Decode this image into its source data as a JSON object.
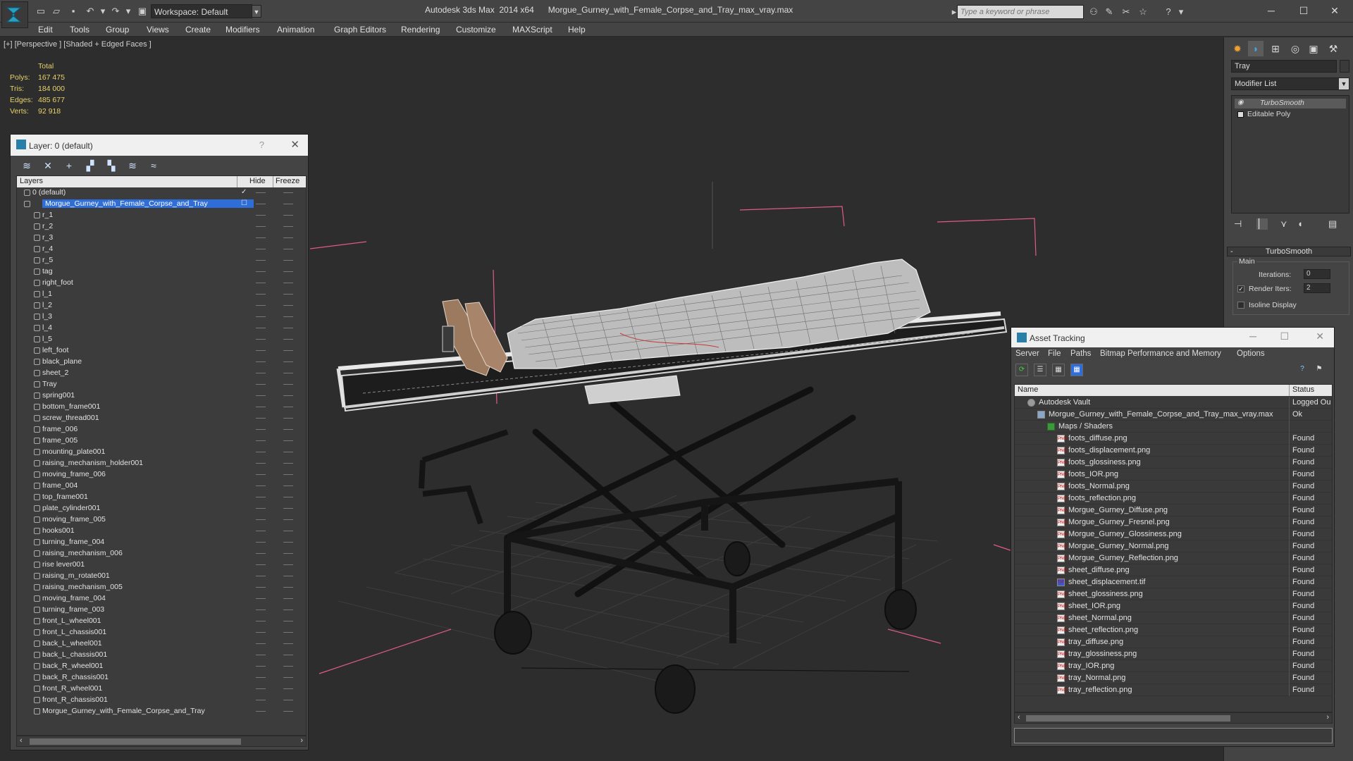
{
  "title_bar": {
    "workspace_label": "Workspace: Default",
    "window_title": "Autodesk 3ds Max  2014 x64      Morgue_Gurney_with_Female_Corpse_and_Tray_max_vray.max",
    "search_placeholder": "Type a keyword or phrase"
  },
  "menu": [
    "Edit",
    "Tools",
    "Group",
    "Views",
    "Create",
    "Modifiers",
    "Animation",
    "Graph Editors",
    "Rendering",
    "Customize",
    "MAXScript",
    "Help"
  ],
  "viewport": {
    "label": "[+] [Perspective ] [Shaded + Edged Faces ]",
    "stats": {
      "header": "Total",
      "rows": [
        {
          "label": "Polys:",
          "value": "167 475"
        },
        {
          "label": "Tris:",
          "value": "184 000"
        },
        {
          "label": "Edges:",
          "value": "485 677"
        },
        {
          "label": "Verts:",
          "value": "92 918"
        }
      ]
    }
  },
  "layer_panel": {
    "title": "Layer: 0 (default)",
    "help": "?",
    "columns": {
      "layers": "Layers",
      "hide": "Hide",
      "freeze": "Freeze"
    },
    "rows": [
      {
        "name": "0 (default)",
        "level": 0,
        "kind": "layer"
      },
      {
        "name": "Morgue_Gurney_with_Female_Corpse_and_Tray",
        "level": 0,
        "kind": "layer",
        "selected": true
      },
      {
        "name": "r_1",
        "level": 1,
        "kind": "object"
      },
      {
        "name": "r_2",
        "level": 1,
        "kind": "object"
      },
      {
        "name": "r_3",
        "level": 1,
        "kind": "object"
      },
      {
        "name": "r_4",
        "level": 1,
        "kind": "object"
      },
      {
        "name": "r_5",
        "level": 1,
        "kind": "object"
      },
      {
        "name": "tag",
        "level": 1,
        "kind": "object"
      },
      {
        "name": "right_foot",
        "level": 1,
        "kind": "object"
      },
      {
        "name": "l_1",
        "level": 1,
        "kind": "object"
      },
      {
        "name": "l_2",
        "level": 1,
        "kind": "object"
      },
      {
        "name": "l_3",
        "level": 1,
        "kind": "object"
      },
      {
        "name": "l_4",
        "level": 1,
        "kind": "object"
      },
      {
        "name": "l_5",
        "level": 1,
        "kind": "object"
      },
      {
        "name": "left_foot",
        "level": 1,
        "kind": "object"
      },
      {
        "name": "black_plane",
        "level": 1,
        "kind": "object"
      },
      {
        "name": "sheet_2",
        "level": 1,
        "kind": "object"
      },
      {
        "name": "Tray",
        "level": 1,
        "kind": "object"
      },
      {
        "name": "spring001",
        "level": 1,
        "kind": "object"
      },
      {
        "name": "bottom_frame001",
        "level": 1,
        "kind": "object"
      },
      {
        "name": "screw_thread001",
        "level": 1,
        "kind": "object"
      },
      {
        "name": "frame_006",
        "level": 1,
        "kind": "object"
      },
      {
        "name": "frame_005",
        "level": 1,
        "kind": "object"
      },
      {
        "name": "mounting_plate001",
        "level": 1,
        "kind": "object"
      },
      {
        "name": "raising_mechanism_holder001",
        "level": 1,
        "kind": "object"
      },
      {
        "name": "moving_frame_006",
        "level": 1,
        "kind": "object"
      },
      {
        "name": "frame_004",
        "level": 1,
        "kind": "object"
      },
      {
        "name": "top_frame001",
        "level": 1,
        "kind": "object"
      },
      {
        "name": "plate_cylinder001",
        "level": 1,
        "kind": "object"
      },
      {
        "name": "moving_frame_005",
        "level": 1,
        "kind": "object"
      },
      {
        "name": "hooks001",
        "level": 1,
        "kind": "object"
      },
      {
        "name": "turning_frame_004",
        "level": 1,
        "kind": "object"
      },
      {
        "name": "raising_mechanism_006",
        "level": 1,
        "kind": "object"
      },
      {
        "name": "rise lever001",
        "level": 1,
        "kind": "object"
      },
      {
        "name": "raising_m_rotate001",
        "level": 1,
        "kind": "object"
      },
      {
        "name": "raising_mechanism_005",
        "level": 1,
        "kind": "object"
      },
      {
        "name": "moving_frame_004",
        "level": 1,
        "kind": "object"
      },
      {
        "name": "turning_frame_003",
        "level": 1,
        "kind": "object"
      },
      {
        "name": "front_L_wheel001",
        "level": 1,
        "kind": "object"
      },
      {
        "name": "front_L_chassis001",
        "level": 1,
        "kind": "object"
      },
      {
        "name": "back_L_wheel001",
        "level": 1,
        "kind": "object"
      },
      {
        "name": "back_L_chassis001",
        "level": 1,
        "kind": "object"
      },
      {
        "name": "back_R_wheel001",
        "level": 1,
        "kind": "object"
      },
      {
        "name": "back_R_chassis001",
        "level": 1,
        "kind": "object"
      },
      {
        "name": "front_R_wheel001",
        "level": 1,
        "kind": "object"
      },
      {
        "name": "front_R_chassis001",
        "level": 1,
        "kind": "object"
      },
      {
        "name": "Morgue_Gurney_with_Female_Corpse_and_Tray",
        "level": 1,
        "kind": "object"
      }
    ]
  },
  "command_panel": {
    "object_name": "Tray",
    "modifier_list": "Modifier List",
    "stack": [
      "TurboSmooth",
      "Editable Poly"
    ],
    "turbosmooth": {
      "header": "TurboSmooth",
      "group": "Main",
      "iterations_label": "Iterations:",
      "iterations": "0",
      "render_iters_label": "Render Iters:",
      "render_iters": "2",
      "render_iters_checked": true,
      "isoline_label": "Isoline Display",
      "isoline_checked": false
    }
  },
  "asset_tracking": {
    "title": "Asset Tracking",
    "menu": [
      "Server",
      "File",
      "Paths",
      "Bitmap Performance and Memory",
      "Options"
    ],
    "columns": {
      "name": "Name",
      "status": "Status"
    },
    "rows": [
      {
        "name": "Autodesk Vault",
        "status": "Logged Ou",
        "level": 0,
        "kind": "vault"
      },
      {
        "name": "Morgue_Gurney_with_Female_Corpse_and_Tray_max_vray.max",
        "status": "Ok",
        "level": 1,
        "kind": "max"
      },
      {
        "name": "Maps / Shaders",
        "status": "",
        "level": 2,
        "kind": "folder"
      },
      {
        "name": "foots_diffuse.png",
        "status": "Found",
        "level": 3,
        "kind": "png"
      },
      {
        "name": "foots_displacement.png",
        "status": "Found",
        "level": 3,
        "kind": "png"
      },
      {
        "name": "foots_glossiness.png",
        "status": "Found",
        "level": 3,
        "kind": "png"
      },
      {
        "name": "foots_IOR.png",
        "status": "Found",
        "level": 3,
        "kind": "png"
      },
      {
        "name": "foots_Normal.png",
        "status": "Found",
        "level": 3,
        "kind": "png"
      },
      {
        "name": "foots_reflection.png",
        "status": "Found",
        "level": 3,
        "kind": "png"
      },
      {
        "name": "Morgue_Gurney_Diffuse.png",
        "status": "Found",
        "level": 3,
        "kind": "png"
      },
      {
        "name": "Morgue_Gurney_Fresnel.png",
        "status": "Found",
        "level": 3,
        "kind": "png"
      },
      {
        "name": "Morgue_Gurney_Glossiness.png",
        "status": "Found",
        "level": 3,
        "kind": "png"
      },
      {
        "name": "Morgue_Gurney_Normal.png",
        "status": "Found",
        "level": 3,
        "kind": "png"
      },
      {
        "name": "Morgue_Gurney_Reflection.png",
        "status": "Found",
        "level": 3,
        "kind": "png"
      },
      {
        "name": "sheet_diffuse.png",
        "status": "Found",
        "level": 3,
        "kind": "png"
      },
      {
        "name": "sheet_displacement.tif",
        "status": "Found",
        "level": 3,
        "kind": "tif"
      },
      {
        "name": "sheet_glossiness.png",
        "status": "Found",
        "level": 3,
        "kind": "png"
      },
      {
        "name": "sheet_IOR.png",
        "status": "Found",
        "level": 3,
        "kind": "png"
      },
      {
        "name": "sheet_Normal.png",
        "status": "Found",
        "level": 3,
        "kind": "png"
      },
      {
        "name": "sheet_reflection.png",
        "status": "Found",
        "level": 3,
        "kind": "png"
      },
      {
        "name": "tray_diffuse.png",
        "status": "Found",
        "level": 3,
        "kind": "png"
      },
      {
        "name": "tray_glossiness.png",
        "status": "Found",
        "level": 3,
        "kind": "png"
      },
      {
        "name": "tray_IOR.png",
        "status": "Found",
        "level": 3,
        "kind": "png"
      },
      {
        "name": "tray_Normal.png",
        "status": "Found",
        "level": 3,
        "kind": "png"
      },
      {
        "name": "tray_reflection.png",
        "status": "Found",
        "level": 3,
        "kind": "png"
      }
    ]
  },
  "colors": {
    "chrome": "#444444",
    "viewport_bg": "#2d2d2d",
    "stats_text": "#e8d36a",
    "selection": "#2f6ed9",
    "gizmo": "#e05a8a"
  }
}
